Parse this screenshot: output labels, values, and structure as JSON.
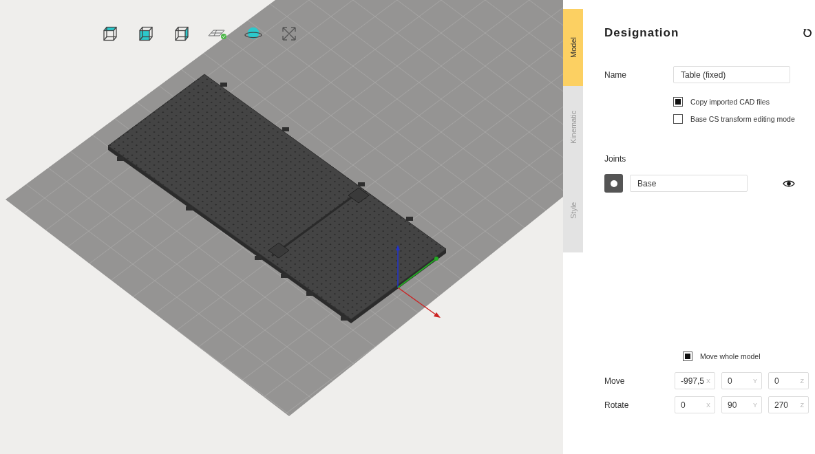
{
  "tabs": [
    {
      "label": "Model",
      "selected": true
    },
    {
      "label": "Kinematic",
      "selected": false
    },
    {
      "label": "Style",
      "selected": false
    }
  ],
  "panel": {
    "title": "Designation",
    "name": {
      "label": "Name",
      "value": "Table (fixed)"
    },
    "options": [
      {
        "label": "Copy imported CAD files",
        "checked": true
      },
      {
        "label": "Base CS transform editing mode",
        "checked": false
      }
    ],
    "joints": {
      "label": "Joints",
      "items": [
        {
          "value": "Base",
          "visible": true
        }
      ]
    },
    "move_whole_model": {
      "label": "Move whole model",
      "checked": true
    },
    "transforms": [
      {
        "label": "Move",
        "fields": [
          {
            "value": "-997,5",
            "axis": "X"
          },
          {
            "value": "0",
            "axis": "Y"
          },
          {
            "value": "0",
            "axis": "Z"
          }
        ]
      },
      {
        "label": "Rotate",
        "fields": [
          {
            "value": "0",
            "axis": "X"
          },
          {
            "value": "90",
            "axis": "Y"
          },
          {
            "value": "270",
            "axis": "Z"
          }
        ]
      }
    ]
  }
}
